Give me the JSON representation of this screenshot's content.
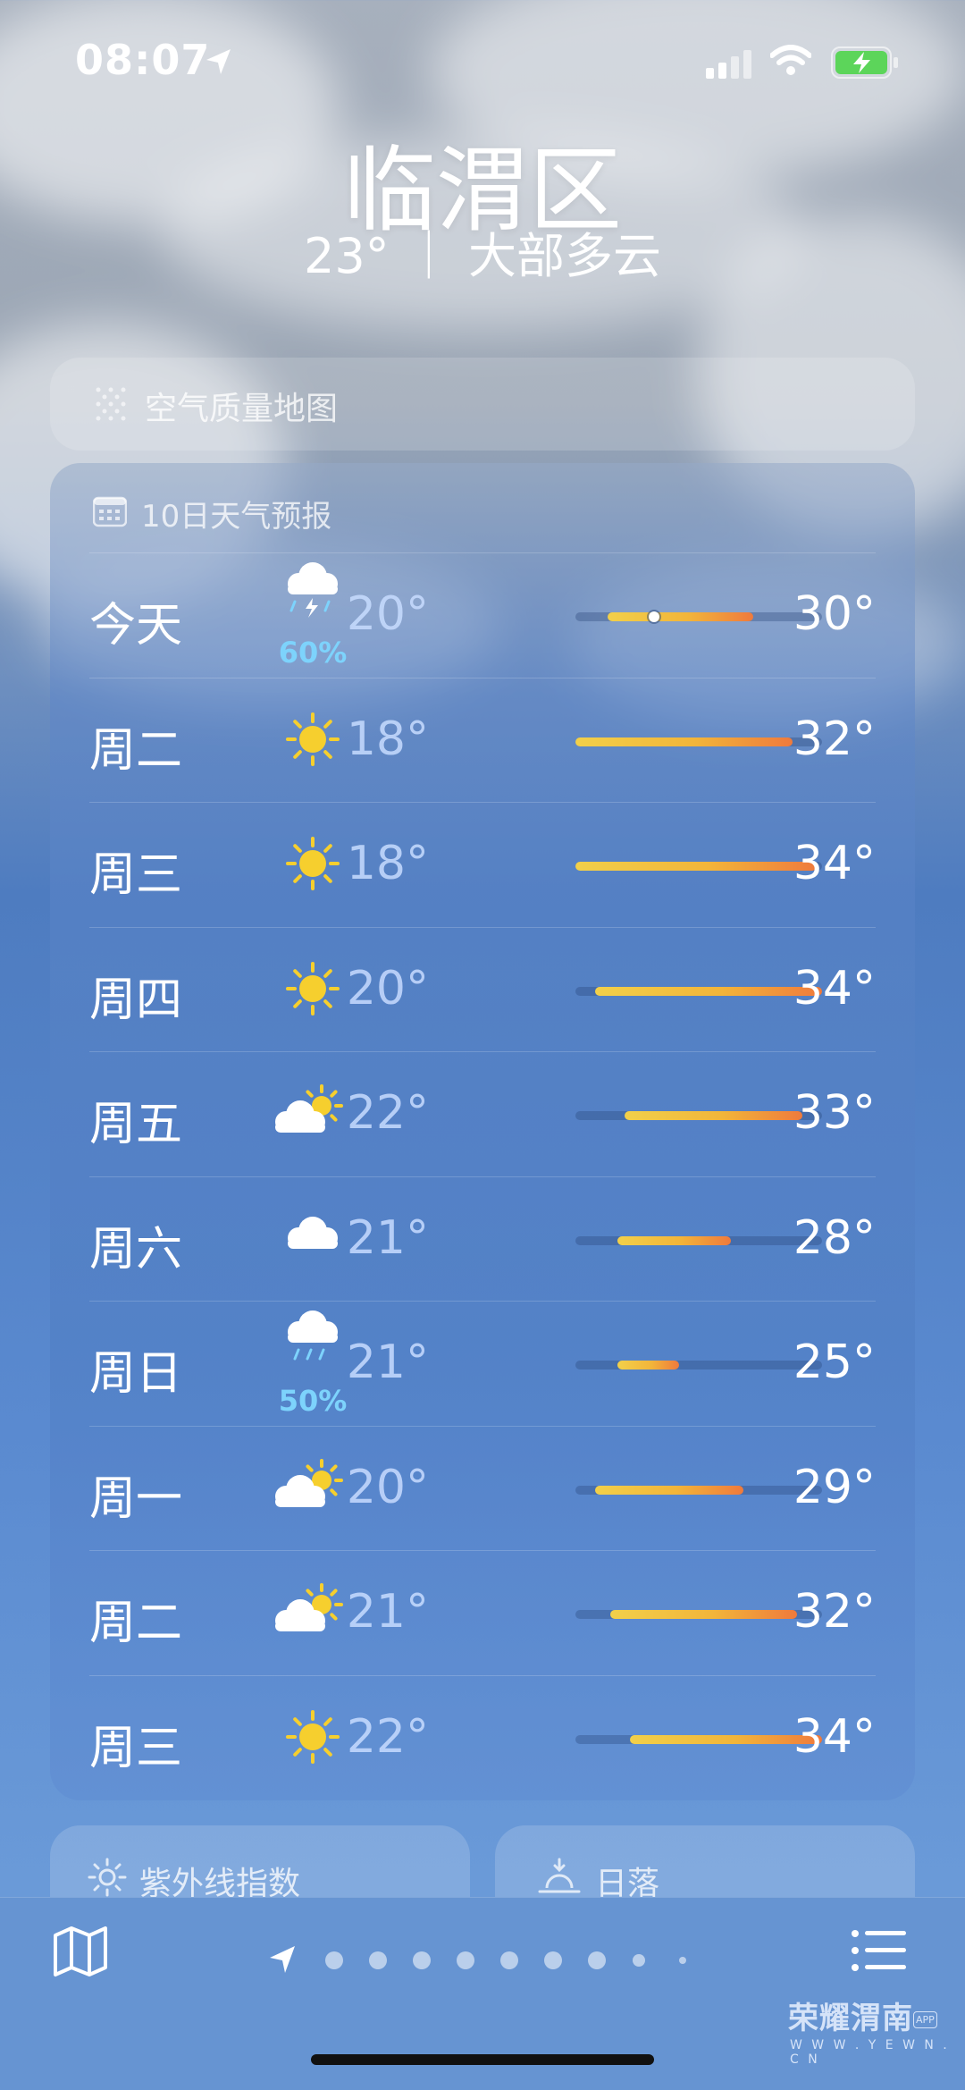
{
  "status": {
    "time": "08:07"
  },
  "header": {
    "city": "临渭区",
    "current": "23° ｜ 大部多云"
  },
  "air_quality": {
    "label": "空气质量地图"
  },
  "forecast": {
    "title": "10日天气预报",
    "days": [
      {
        "day": "今天",
        "icon": "cloud-bolt-rain-icon",
        "pop": "60%",
        "low": "20°",
        "high": "30°",
        "range": [
          0.13,
          0.72
        ],
        "current": 0.32
      },
      {
        "day": "周二",
        "icon": "sun-icon",
        "pop": "",
        "low": "18°",
        "high": "32°",
        "range": [
          0.0,
          0.88
        ]
      },
      {
        "day": "周三",
        "icon": "sun-icon",
        "pop": "",
        "low": "18°",
        "high": "34°",
        "range": [
          0.0,
          0.98
        ]
      },
      {
        "day": "周四",
        "icon": "sun-icon",
        "pop": "",
        "low": "20°",
        "high": "34°",
        "range": [
          0.08,
          1.0
        ]
      },
      {
        "day": "周五",
        "icon": "sun-cloud-icon",
        "pop": "",
        "low": "22°",
        "high": "33°",
        "range": [
          0.2,
          0.92
        ]
      },
      {
        "day": "周六",
        "icon": "cloud-icon",
        "pop": "",
        "low": "21°",
        "high": "28°",
        "range": [
          0.17,
          0.63
        ]
      },
      {
        "day": "周日",
        "icon": "cloud-rain-icon",
        "pop": "50%",
        "low": "21°",
        "high": "25°",
        "range": [
          0.17,
          0.42
        ]
      },
      {
        "day": "周一",
        "icon": "sun-cloud-icon",
        "pop": "",
        "low": "20°",
        "high": "29°",
        "range": [
          0.08,
          0.68
        ]
      },
      {
        "day": "周二",
        "icon": "sun-cloud-icon",
        "pop": "",
        "low": "21°",
        "high": "32°",
        "range": [
          0.14,
          0.9
        ]
      },
      {
        "day": "周三",
        "icon": "sun-icon",
        "pop": "",
        "low": "22°",
        "high": "34°",
        "range": [
          0.22,
          1.0
        ]
      }
    ]
  },
  "uv": {
    "label": "紫外线指数"
  },
  "sunset": {
    "label": "日落"
  },
  "watermark": {
    "name": "荣耀渭南",
    "url": "W W W . Y E W N . C N",
    "tag": "APP"
  },
  "colors": {
    "bar_start": "#f2d04a",
    "bar_mid": "#f2b53a",
    "bar_end": "#ef7a3c",
    "sun": "#f6cf2e",
    "precip": "#7dd3fc"
  }
}
